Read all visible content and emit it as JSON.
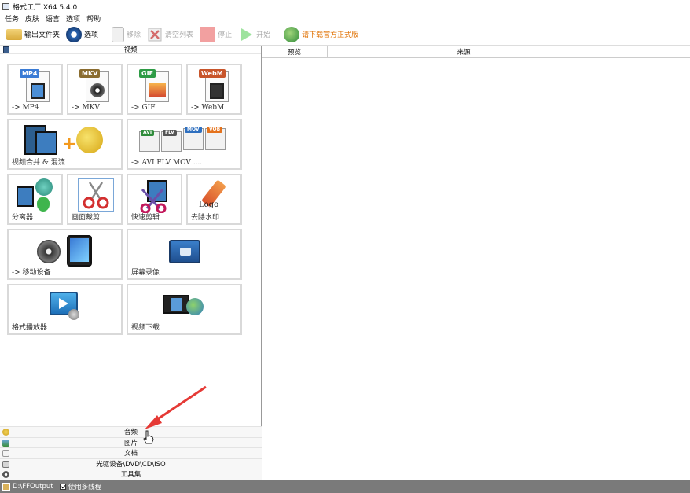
{
  "window": {
    "title": "格式工厂 X64 5.4.0"
  },
  "menu": [
    "任务",
    "皮肤",
    "语言",
    "选项",
    "帮助"
  ],
  "toolbar": {
    "output_folder": "输出文件夹",
    "options": "选项",
    "remove": "移除",
    "clear_list": "清空列表",
    "stop": "停止",
    "start": "开始",
    "download_official": "请下载官方正式版"
  },
  "left_panel": {
    "header": "视频",
    "tiles": [
      {
        "name": "tile-mp4",
        "caption": "-> MP4",
        "badge": "MP4",
        "badge_color": "#3a7bd5"
      },
      {
        "name": "tile-mkv",
        "caption": "-> MKV",
        "badge": "MKV",
        "badge_color": "#6d4c9e"
      },
      {
        "name": "tile-gif",
        "caption": "-> GIF",
        "badge": "GIF",
        "badge_color": "#2e9b45"
      },
      {
        "name": "tile-webm",
        "caption": "-> WebM",
        "badge": "WebM",
        "badge_color": "#c8552b"
      },
      {
        "name": "tile-merge",
        "caption": "视频合并 & 混流"
      },
      {
        "name": "tile-multi-format",
        "caption": "-> AVI FLV MOV ....",
        "badges": [
          "AVI",
          "FLV",
          "MOV",
          "VOB"
        ]
      },
      {
        "name": "tile-splitter",
        "caption": "分离器"
      },
      {
        "name": "tile-crop",
        "caption": "画面裁剪"
      },
      {
        "name": "tile-quick-cut",
        "caption": "快速剪辑"
      },
      {
        "name": "tile-remove-watermark",
        "caption": "去除水印",
        "logo_text": "Logo"
      },
      {
        "name": "tile-mobile",
        "caption": "-> 移动设备"
      },
      {
        "name": "tile-screen-record",
        "caption": "屏幕录像"
      },
      {
        "name": "tile-player",
        "caption": "格式播放器"
      },
      {
        "name": "tile-video-download",
        "caption": "视频下载"
      }
    ],
    "sections": [
      "音频",
      "图片",
      "文档",
      "光驱设备\\DVD\\CD\\ISO",
      "工具集"
    ]
  },
  "task_list": {
    "columns": [
      "预览",
      "来源"
    ]
  },
  "status_bar": {
    "output_path": "D:\\FFOutput",
    "multithread_label": "使用多线程",
    "multithread_checked": true
  }
}
